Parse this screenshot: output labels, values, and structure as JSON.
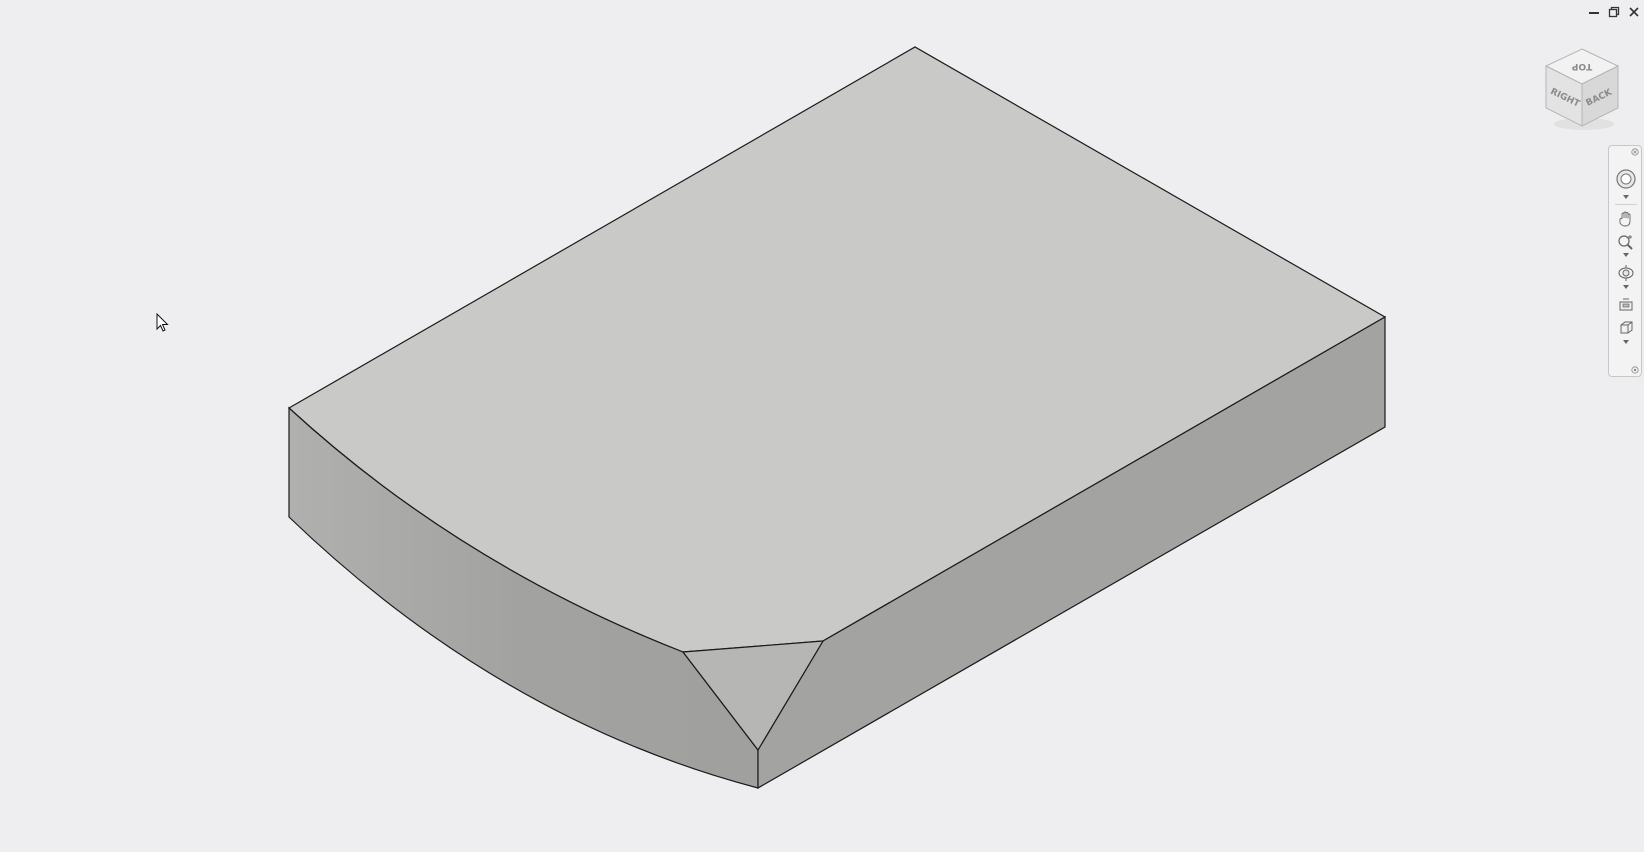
{
  "window_controls": [
    {
      "name": "minimize-button",
      "icon": "minimize-icon"
    },
    {
      "name": "restore-button",
      "icon": "restore-icon"
    },
    {
      "name": "close-button",
      "icon": "close-icon"
    }
  ],
  "viewcube": {
    "faces": {
      "top": "TOP",
      "right": "RIGHT",
      "back": "BACK"
    }
  },
  "navigation_bar": {
    "tools": [
      {
        "name": "steering-wheel-button",
        "icon": "steering-wheel-icon"
      },
      {
        "name": "pan-button",
        "icon": "pan-hand-icon"
      },
      {
        "name": "zoom-button",
        "icon": "zoom-icon"
      },
      {
        "name": "orbit-button",
        "icon": "orbit-icon"
      },
      {
        "name": "look-at-button",
        "icon": "look-at-icon"
      },
      {
        "name": "view-face-button",
        "icon": "view-face-icon"
      }
    ]
  },
  "colors": {
    "background": "#eeedf0",
    "top_face": "#c8c8c6",
    "side_face": "#a3a3a1",
    "edge": "#1a1a1a"
  }
}
